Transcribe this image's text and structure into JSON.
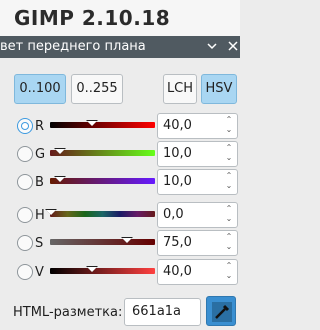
{
  "app_title": "GIMP 2.10.18",
  "dialog": {
    "title": "вет переднего плана",
    "menu_icon": "chevron-down",
    "close_icon": "close"
  },
  "modes": {
    "range_0_100": "0..100",
    "range_0_255": "0..255",
    "lch": "LCH",
    "hsv": "HSV"
  },
  "channels": [
    {
      "key": "R",
      "label": "R",
      "value": "40,0",
      "checked": true
    },
    {
      "key": "G",
      "label": "G",
      "value": "10,0",
      "checked": false
    },
    {
      "key": "B",
      "label": "B",
      "value": "10,0",
      "checked": false
    },
    {
      "key": "H",
      "label": "H",
      "value": "0,0",
      "checked": false
    },
    {
      "key": "S",
      "label": "S",
      "value": "75,0",
      "checked": false
    },
    {
      "key": "V",
      "label": "V",
      "value": "40,0",
      "checked": false
    }
  ],
  "html_notation": {
    "label": "HTML-разметка:",
    "value": "661a1a"
  },
  "colors": {
    "accent": "#3a8fd1",
    "active_mode": "#a9d6f2",
    "header": "#505a61"
  }
}
